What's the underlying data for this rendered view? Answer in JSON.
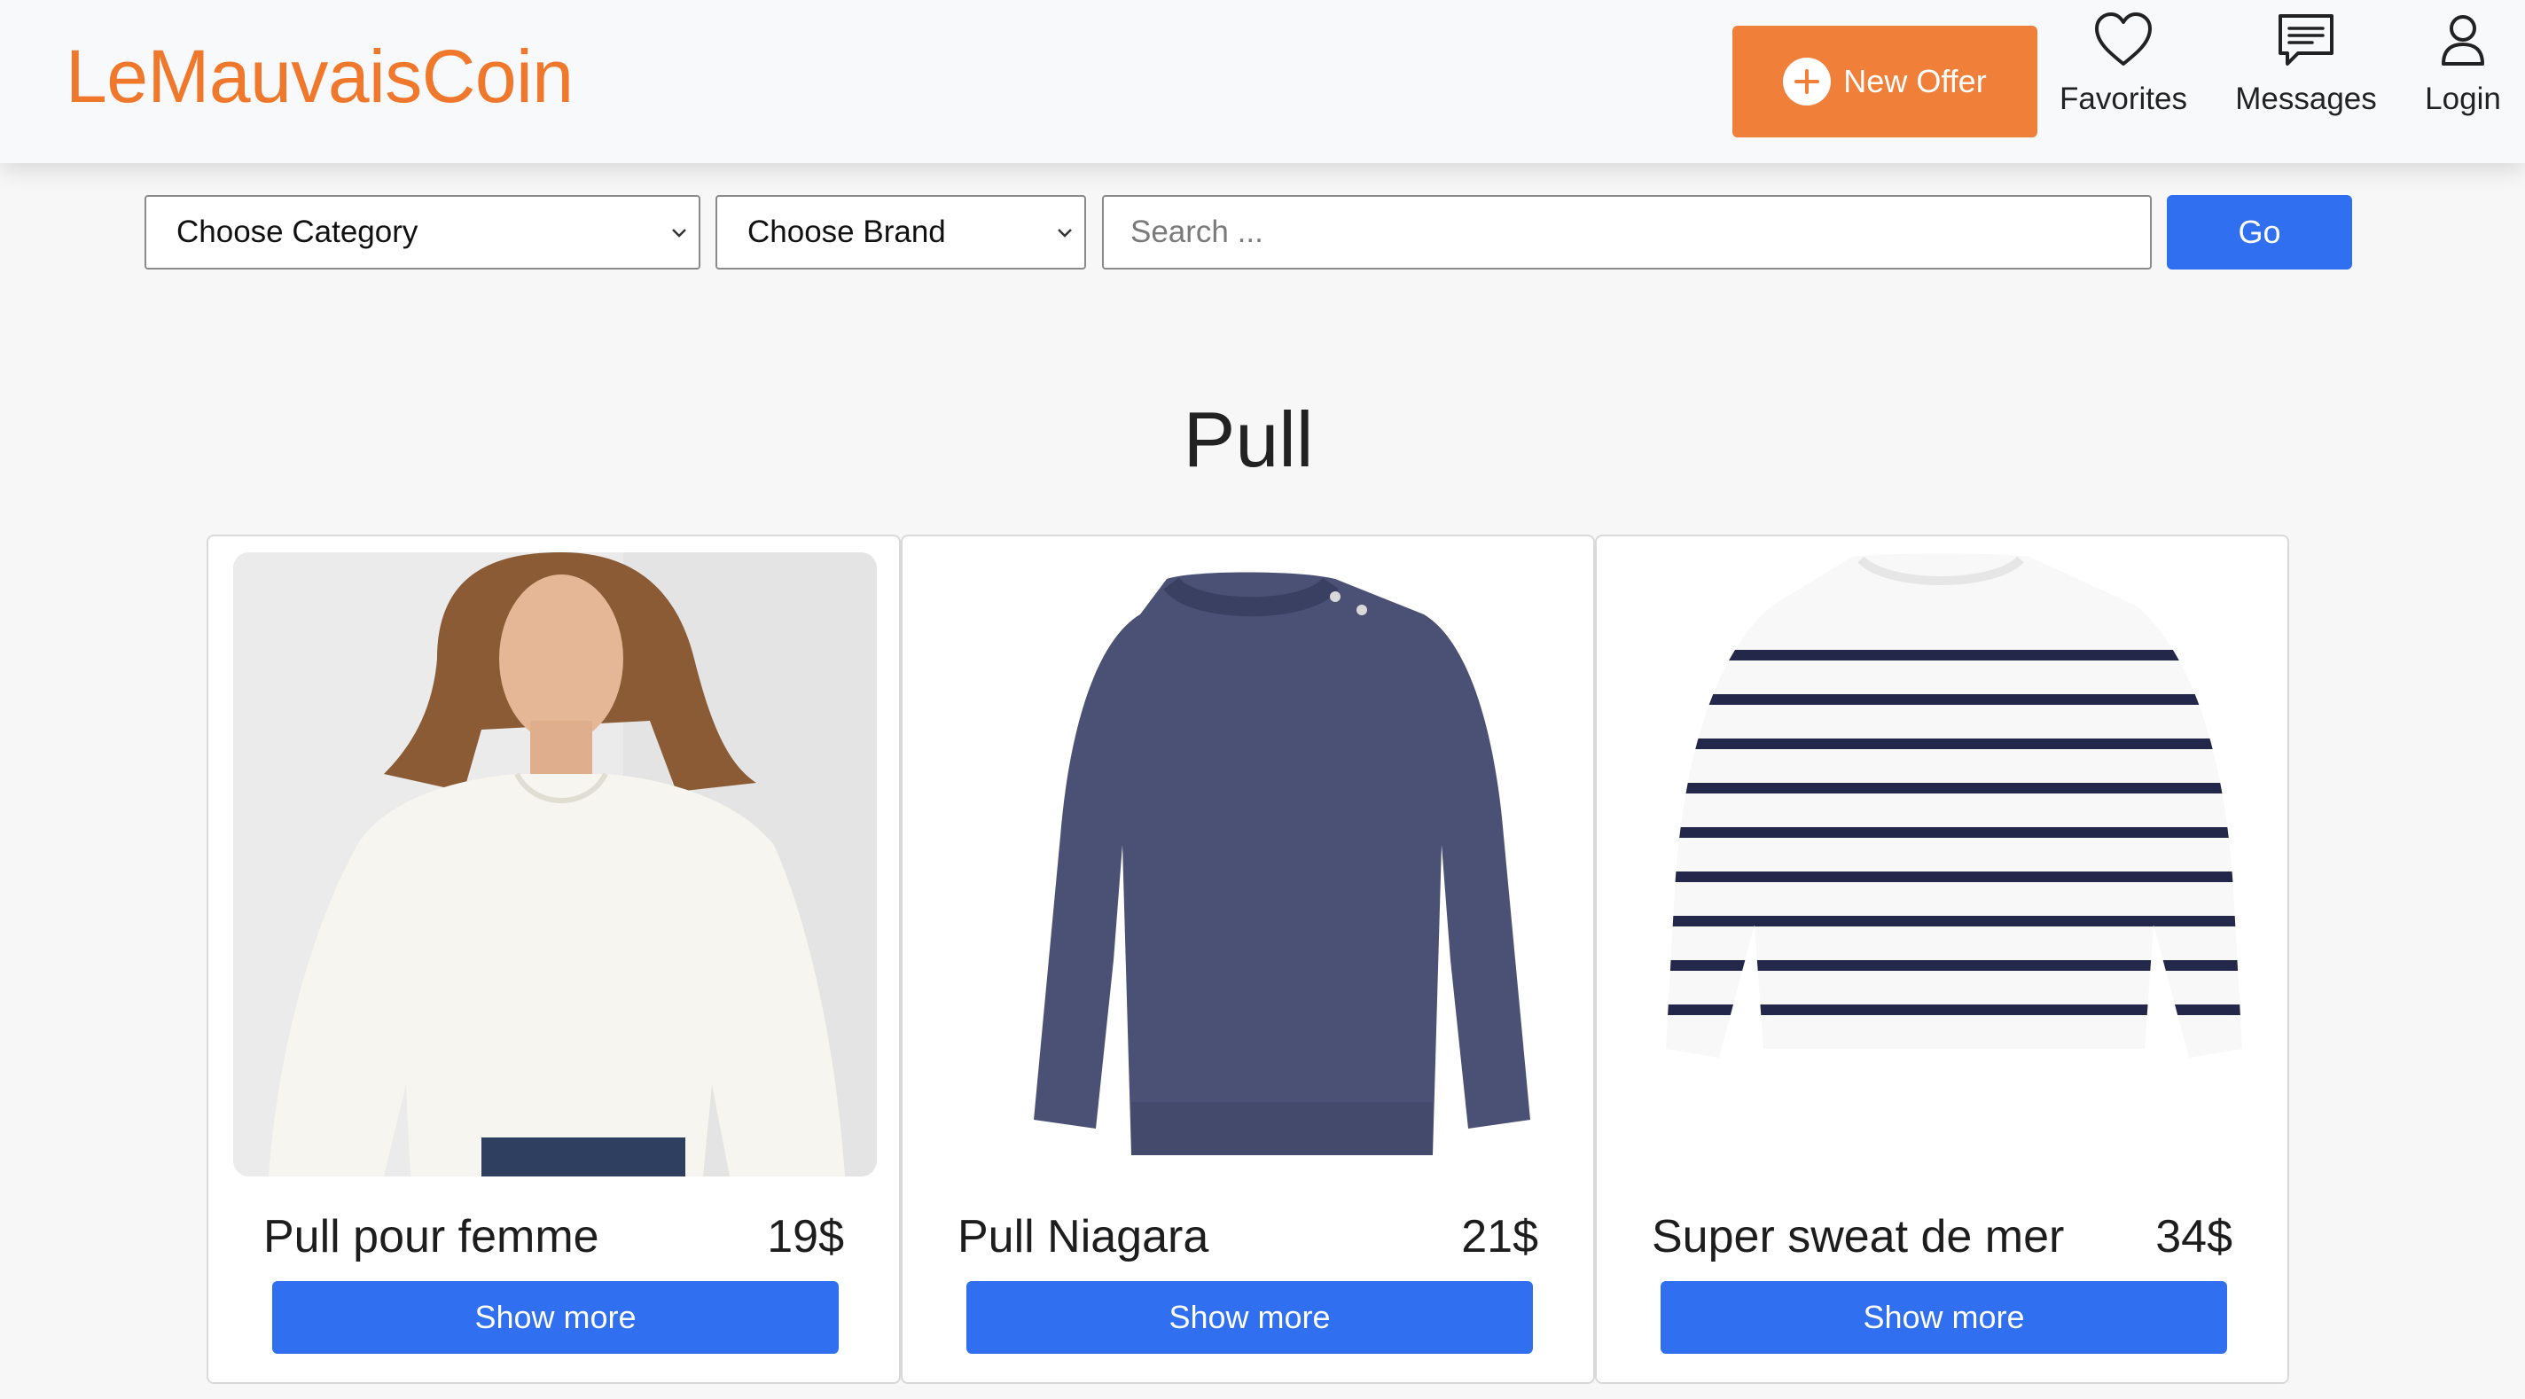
{
  "header": {
    "brand": "LeMauvaisCoin",
    "new_offer_label": "New Offer",
    "nav": {
      "favorites": "Favorites",
      "messages": "Messages",
      "login": "Login"
    }
  },
  "filters": {
    "category_selected": "Choose Category",
    "brand_selected": "Choose Brand",
    "search_placeholder": "Search ...",
    "go_label": "Go"
  },
  "section_title": "Pull",
  "products": [
    {
      "name": "Pull pour femme",
      "price": "19$",
      "button": "Show more"
    },
    {
      "name": "Pull Niagara",
      "price": "21$",
      "button": "Show more"
    },
    {
      "name": "Super sweat de mer",
      "price": "34$",
      "button": "Show more"
    }
  ],
  "colors": {
    "brand": "#f0782c",
    "primary_button": "#2f6ff0",
    "new_offer_button": "#f07f3a"
  }
}
